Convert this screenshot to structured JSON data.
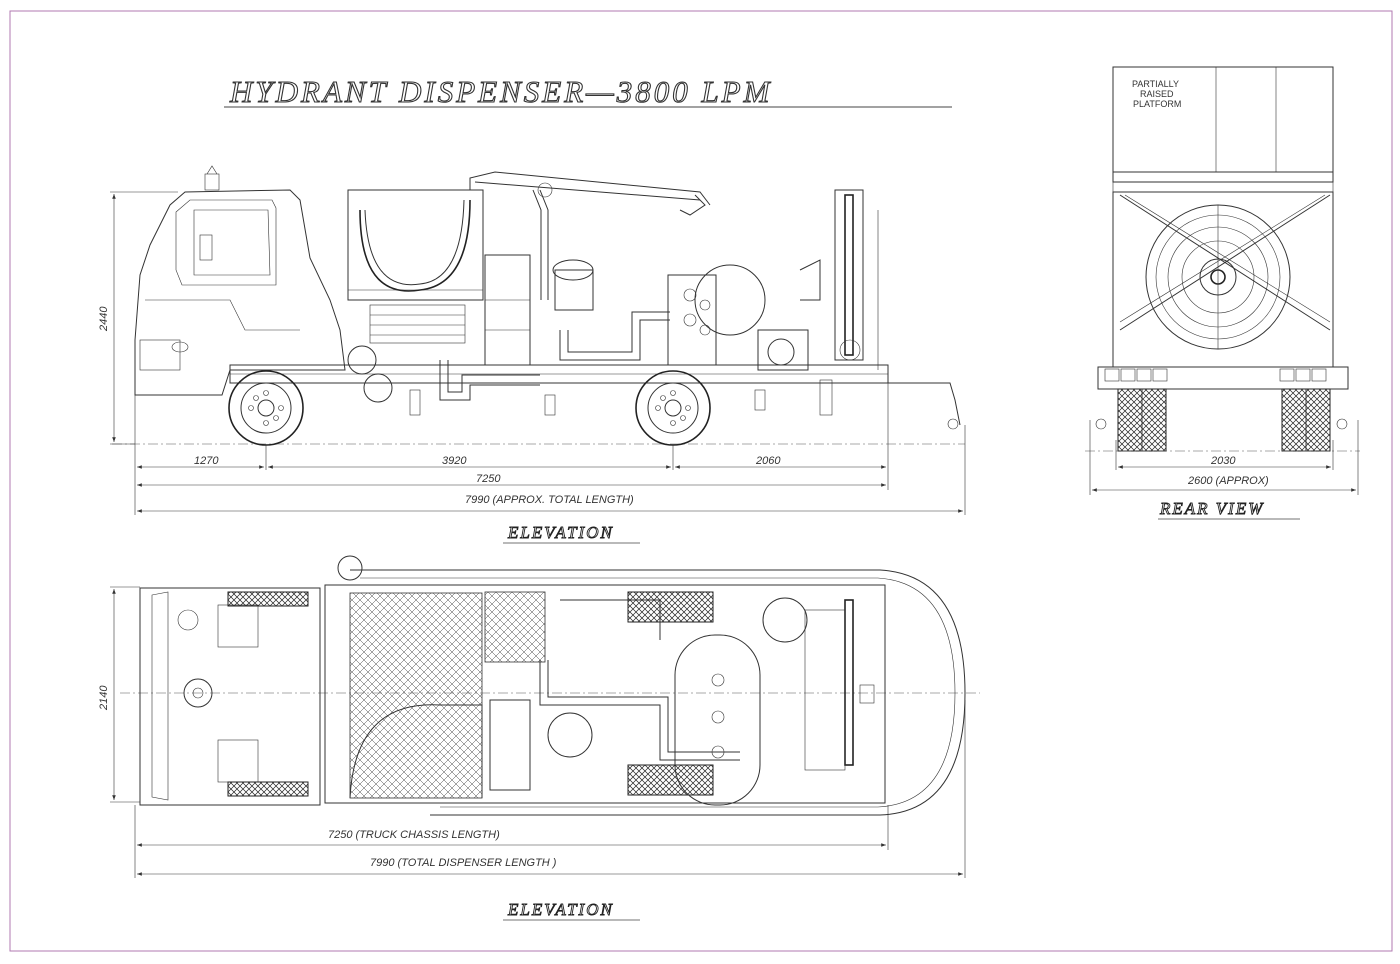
{
  "title": "HYDRANT DISPENSER—3800 LPM",
  "elevation": {
    "caption": "ELEVATION",
    "height_dim": "2440",
    "dims": [
      "1270",
      "3920",
      "2060",
      "7250",
      "7990 (APPROX. TOTAL LENGTH)"
    ]
  },
  "rear_view": {
    "caption": "REAR VIEW",
    "platform_note": [
      "PARTIALLY",
      "RAISED",
      "PLATFORM"
    ],
    "dims": [
      "2030",
      "2600 (APPROX)"
    ]
  },
  "plan": {
    "caption": "ELEVATION",
    "width_dim": "2140",
    "dims": [
      "7250 (TRUCK CHASSIS LENGTH)",
      "7990 (TOTAL DISPENSER LENGTH )"
    ]
  }
}
